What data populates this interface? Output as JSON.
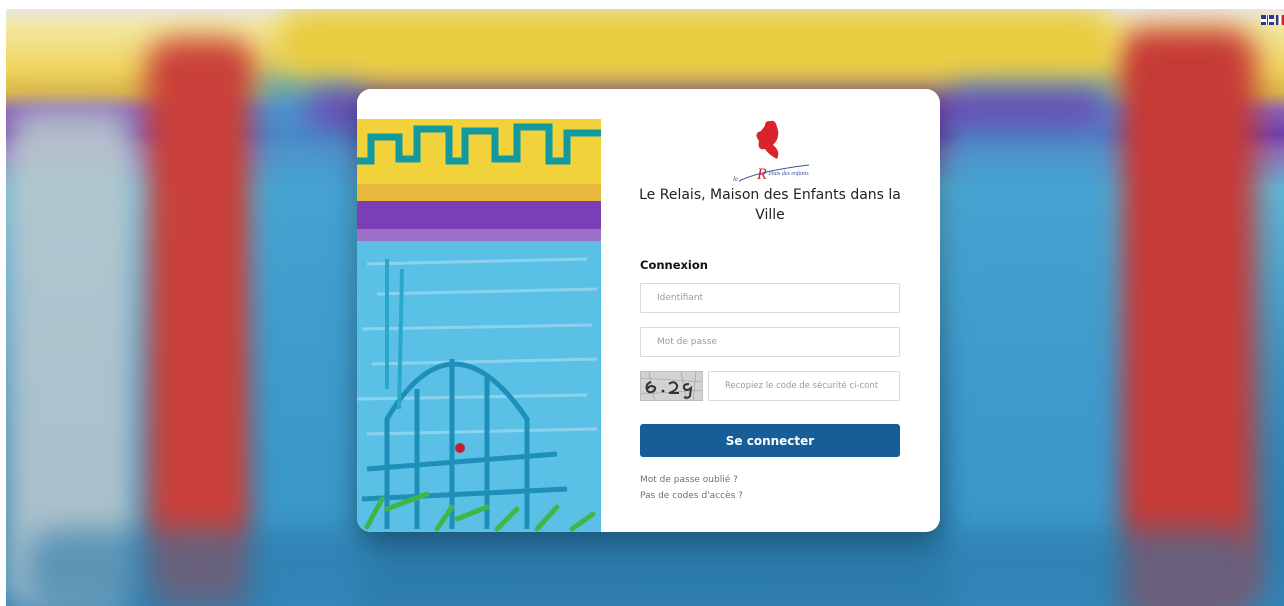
{
  "languages": [
    {
      "code": "en",
      "icon": "uk-flag-icon"
    },
    {
      "code": "fr",
      "icon": "fr-flag-icon"
    }
  ],
  "organization": {
    "name": "Le Relais, Maison des Enfants dans la Ville"
  },
  "login": {
    "title": "Connexion",
    "username_placeholder": "Identifiant",
    "password_placeholder": "Mot de passe",
    "captcha_placeholder": "Recopiez le code de sécurité ci-cont",
    "submit_label": "Se connecter",
    "forgot_password_link": "Mot de passe oublié ?",
    "no_access_code_link": "Pas de codes d'accès ?"
  },
  "colors": {
    "primary_button": "#175e98",
    "logo_red": "#d9232d"
  }
}
